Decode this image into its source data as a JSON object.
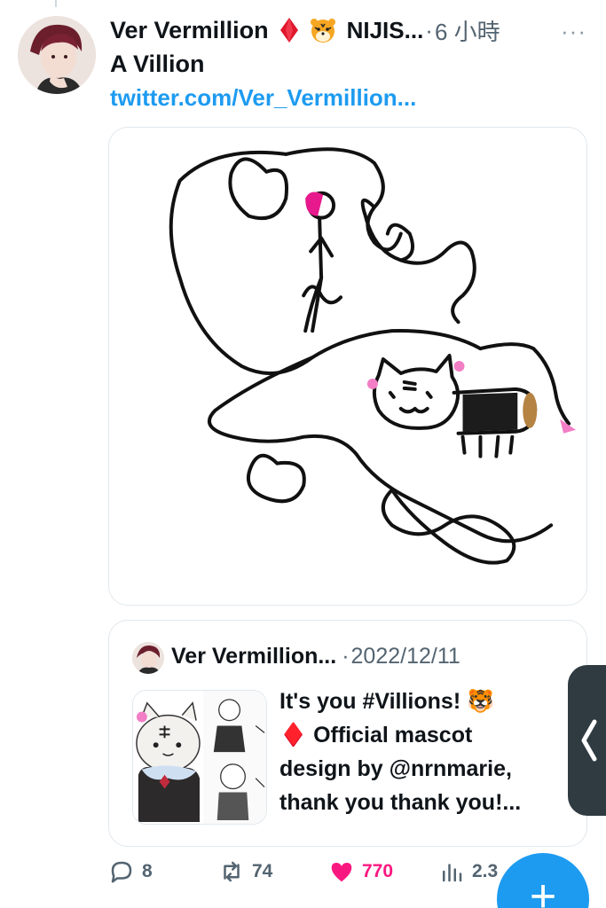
{
  "tweet": {
    "author_name": "Ver Vermillion",
    "affiliation": "NIJIS...",
    "separator": "·",
    "time": "6 小時",
    "more": "···",
    "text": "A Villion",
    "link": "twitter.com/Ver_Vermillion..."
  },
  "quote": {
    "author_name": "Ver Vermillion...",
    "separator": "·",
    "date": "2022/12/11",
    "text_lines": [
      "It's you #Villions! 🐯",
      "♦️ Official mascot",
      "design by @nrnmarie,",
      "thank you thank you!..."
    ]
  },
  "actions": {
    "replies": "8",
    "retweets": "74",
    "likes": "770",
    "views": "2.3"
  },
  "fab": {
    "label": "+"
  },
  "icons": {
    "diamond": "diamond-emoji-icon",
    "tiger": "tiger-emoji-icon",
    "reply": "reply-icon",
    "retweet": "retweet-icon",
    "like": "heart-icon",
    "views": "views-icon"
  },
  "colors": {
    "link": "#1d9bf0",
    "like": "#f91880",
    "muted": "#536471",
    "text": "#0f1419"
  }
}
